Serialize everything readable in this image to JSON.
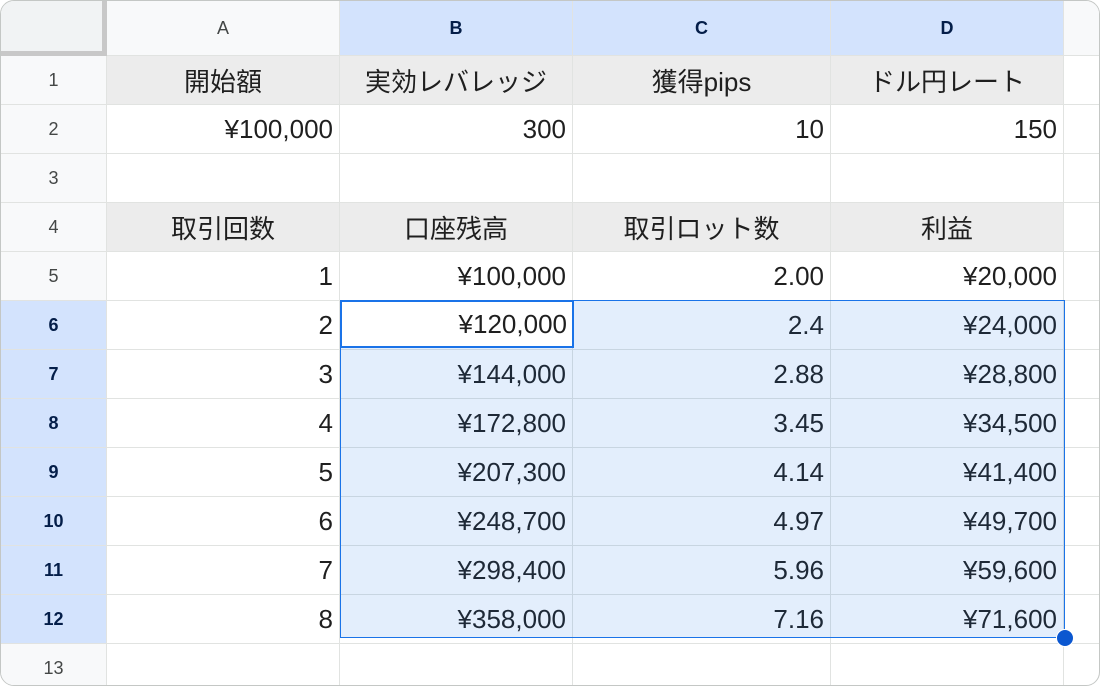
{
  "columns": [
    "A",
    "B",
    "C",
    "D"
  ],
  "row_numbers": [
    "1",
    "2",
    "3",
    "4",
    "5",
    "6",
    "7",
    "8",
    "9",
    "10",
    "11",
    "12",
    "13"
  ],
  "rows": [
    [
      "開始額",
      "実効レバレッジ",
      "獲得pips",
      "ドル円レート"
    ],
    [
      "¥100,000",
      "300",
      "10",
      "150"
    ],
    [
      "",
      "",
      "",
      ""
    ],
    [
      "取引回数",
      "口座残高",
      "取引ロット数",
      "利益"
    ],
    [
      "1",
      "¥100,000",
      "2.00",
      "¥20,000"
    ],
    [
      "2",
      "¥120,000",
      "2.4",
      "¥24,000"
    ],
    [
      "3",
      "¥144,000",
      "2.88",
      "¥28,800"
    ],
    [
      "4",
      "¥172,800",
      "3.45",
      "¥34,500"
    ],
    [
      "5",
      "¥207,300",
      "4.14",
      "¥41,400"
    ],
    [
      "6",
      "¥248,700",
      "4.97",
      "¥49,700"
    ],
    [
      "7",
      "¥298,400",
      "5.96",
      "¥59,600"
    ],
    [
      "8",
      "¥358,000",
      "7.16",
      "¥71,600"
    ],
    [
      "",
      "",
      "",
      ""
    ]
  ],
  "selection": {
    "range": "B6:D12",
    "active_cell": "B6"
  },
  "colors": {
    "selection_border": "#1a73e8",
    "selection_fill": "#e8f0fe",
    "header_highlight": "#d3e3fd",
    "label_row_fill": "#ececec"
  }
}
